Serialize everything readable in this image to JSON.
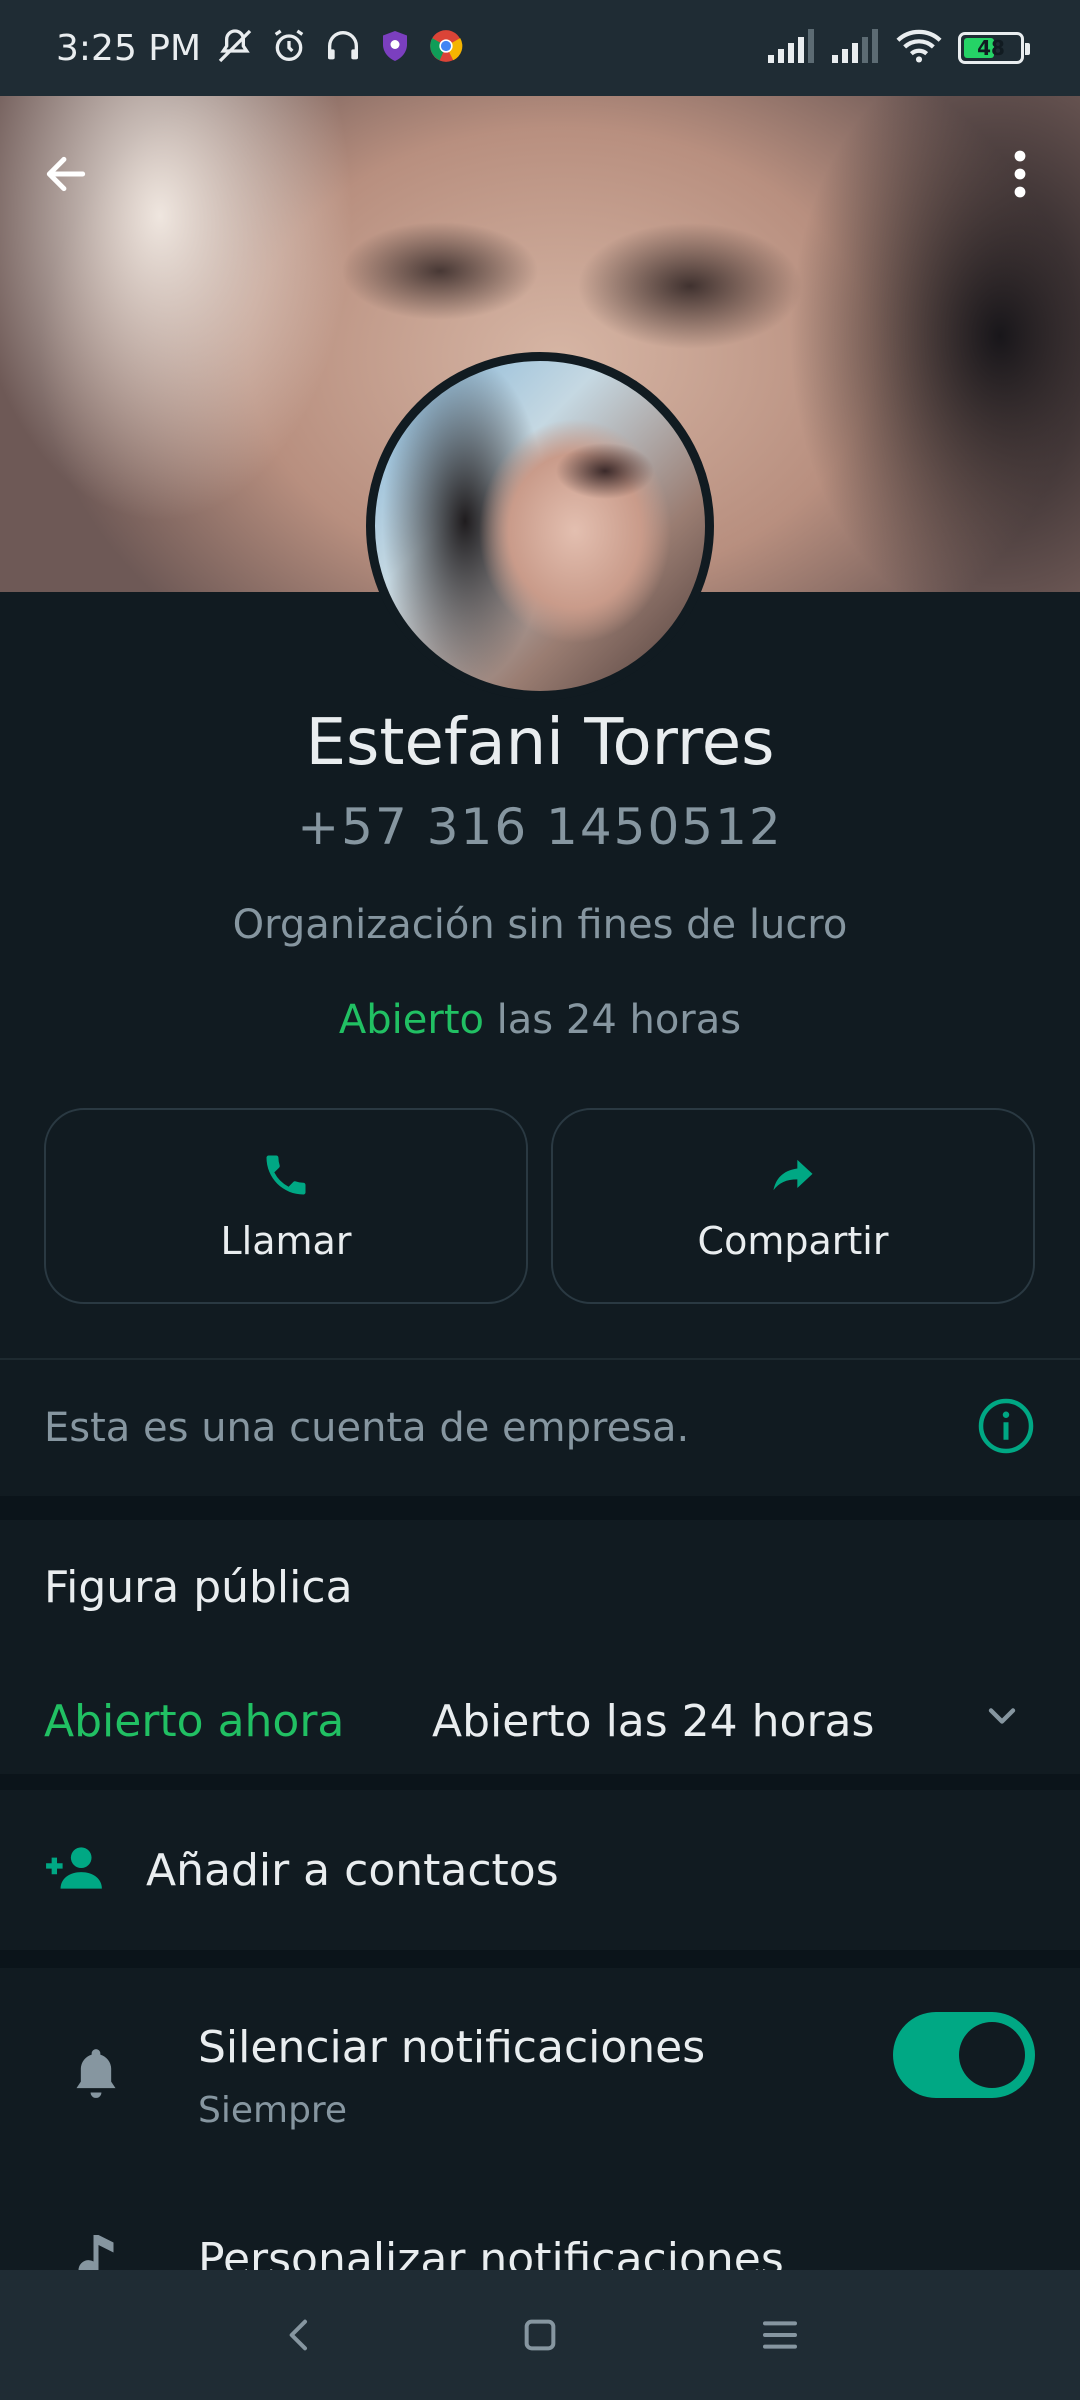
{
  "status_bar": {
    "time": "3:25 PM",
    "battery_level": "48",
    "left_icons": [
      "mute-bell-icon",
      "alarm-icon",
      "headset-icon",
      "shield-app-icon",
      "chrome-icon"
    ],
    "right_icons": [
      "signal-icon",
      "signal-icon",
      "wifi-icon",
      "battery-icon"
    ]
  },
  "header": {
    "back_icon": "arrow-left-icon",
    "menu_icon": "more-vertical-icon"
  },
  "profile": {
    "name": "Estefani Torres",
    "phone": "+57 316 1450512",
    "category": "Organización sin fines de lucro",
    "hours_open": "Abierto",
    "hours_rest": " las 24 horas"
  },
  "actions": {
    "call_label": "Llamar",
    "share_label": "Compartir"
  },
  "business_notice": "Esta es una cuenta de empresa.",
  "business_section": {
    "title": "Figura pública",
    "open_now": "Abierto ahora",
    "hours_range": "Abierto las 24 horas"
  },
  "add_contact_label": "Añadir a contactos",
  "mute": {
    "label": "Silenciar notificaciones",
    "sub": "Siempre",
    "enabled": true
  },
  "custom_notifications_label": "Personalizar notificaciones",
  "colors": {
    "accent": "#00a884",
    "green_text": "#21c063",
    "background": "#111b21",
    "secondary_text": "#8696a0"
  }
}
